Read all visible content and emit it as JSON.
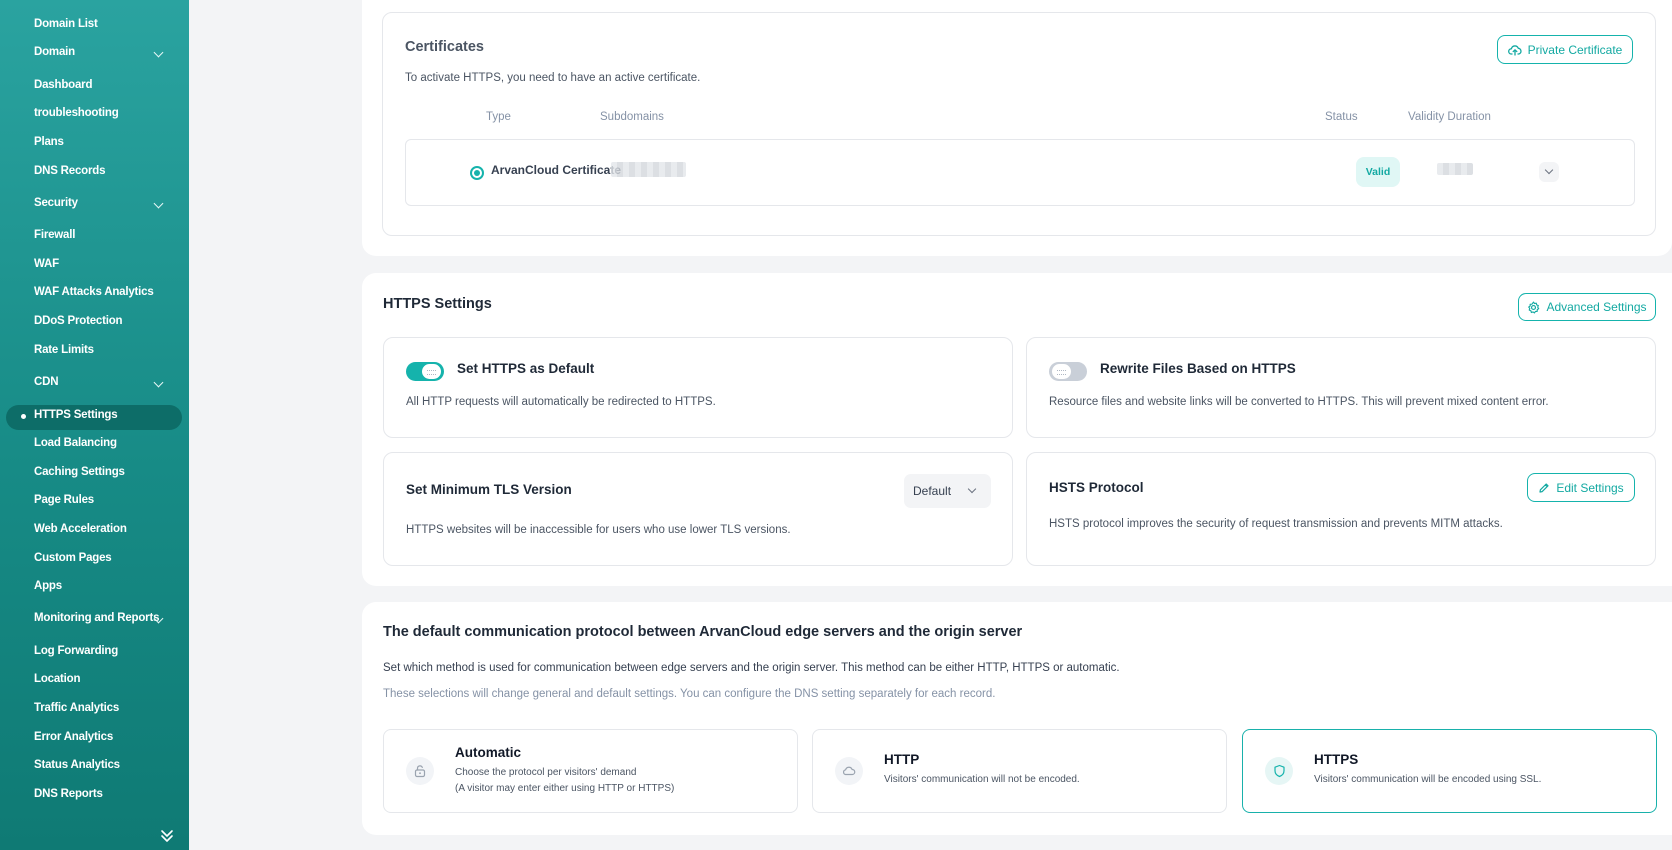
{
  "sidebar": {
    "items": [
      {
        "label": "Domain List"
      },
      {
        "label": "Domain",
        "expandable": true
      },
      {
        "label": "Dashboard"
      },
      {
        "label": "troubleshooting"
      },
      {
        "label": "Plans"
      },
      {
        "label": "DNS Records"
      },
      {
        "label": "Security",
        "expandable": true
      },
      {
        "label": "Firewall"
      },
      {
        "label": "WAF"
      },
      {
        "label": "WAF Attacks Analytics"
      },
      {
        "label": "DDoS Protection"
      },
      {
        "label": "Rate Limits"
      },
      {
        "label": "CDN",
        "expandable": true
      },
      {
        "label": "HTTPS Settings",
        "active": true
      },
      {
        "label": "Load Balancing"
      },
      {
        "label": "Caching Settings"
      },
      {
        "label": "Page Rules"
      },
      {
        "label": "Web Acceleration"
      },
      {
        "label": "Custom Pages"
      },
      {
        "label": "Apps"
      },
      {
        "label": "Monitoring and Reports",
        "expandable": true
      },
      {
        "label": "Log Forwarding"
      },
      {
        "label": "Location"
      },
      {
        "label": "Traffic Analytics"
      },
      {
        "label": "Error Analytics"
      },
      {
        "label": "Status Analytics"
      },
      {
        "label": "DNS Reports"
      }
    ]
  },
  "certificates": {
    "title": "Certificates",
    "description": "To activate HTTPS, you need to have an active certificate.",
    "private_button": "Private Certificate",
    "columns": {
      "type": "Type",
      "subdomains": "Subdomains",
      "status": "Status",
      "validity": "Validity Duration"
    },
    "row": {
      "type": "ArvanCloud Certificate",
      "status": "Valid"
    }
  },
  "https_settings": {
    "title": "HTTPS Settings",
    "advanced_button": "Advanced Settings",
    "default_https": {
      "title": "Set HTTPS as Default",
      "description": "All HTTP requests will automatically be redirected to HTTPS.",
      "enabled": true
    },
    "rewrite_files": {
      "title": "Rewrite Files Based on HTTPS",
      "description": "Resource files and website links will be converted to HTTPS. This will prevent mixed content error.",
      "enabled": false
    },
    "min_tls": {
      "title": "Set Minimum TLS Version",
      "description": "HTTPS websites will be inaccessible for users who use lower TLS versions.",
      "selected": "Default"
    },
    "hsts": {
      "title": "HSTS Protocol",
      "description": "HSTS protocol improves the security of request transmission and prevents MITM attacks.",
      "edit_button": "Edit Settings"
    }
  },
  "protocol": {
    "title": "The default communication protocol between ArvanCloud edge servers and the origin server",
    "description": "Set which method is used for communication between edge servers and the origin server. This method can be either HTTP, HTTPS or automatic.",
    "note": "These selections will change general and default settings. You can configure the DNS setting separately for each record.",
    "options": [
      {
        "title": "Automatic",
        "line1": "Choose the protocol per visitors' demand",
        "line2": "(A visitor may enter either using HTTP or HTTPS)"
      },
      {
        "title": "HTTP",
        "line1": "Visitors' communication will not be encoded."
      },
      {
        "title": "HTTPS",
        "line1": "Visitors' communication will be encoded using SSL.",
        "selected": true
      }
    ]
  },
  "colors": {
    "accent": "#15b3ac",
    "sidebar_top": "#2aa3a0",
    "sidebar_bottom": "#0f7a74",
    "valid_badge_bg": "#e0f7f5"
  }
}
